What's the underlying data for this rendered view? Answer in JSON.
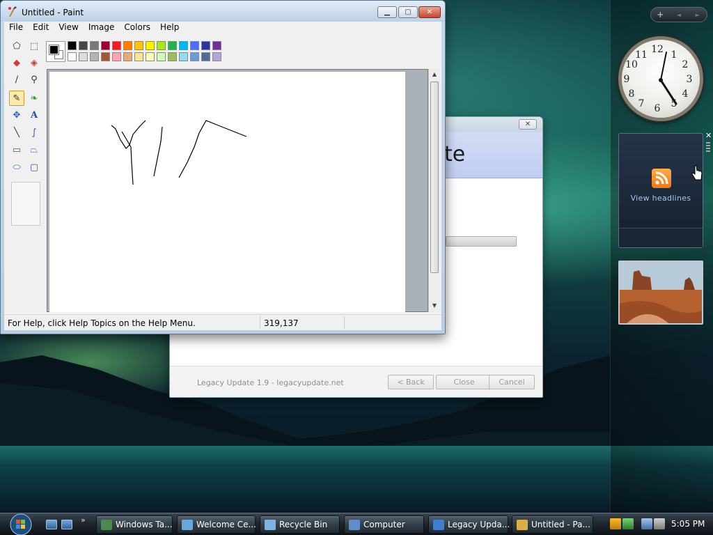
{
  "paint": {
    "title": "Untitled - Paint",
    "menus": [
      "File",
      "Edit",
      "View",
      "Image",
      "Colors",
      "Help"
    ],
    "status_help": "For Help, click Help Topics on the Help Menu.",
    "status_coords": "319,137",
    "palette_top": [
      "#000000",
      "#464646",
      "#787878",
      "#990030",
      "#ed1c24",
      "#ff7e00",
      "#ffc20e",
      "#fff200",
      "#a8e61d",
      "#22b14c",
      "#00b7ef",
      "#4d6df3",
      "#2f3699",
      "#6f3198"
    ],
    "palette_bottom": [
      "#ffffff",
      "#dcdcdc",
      "#b4b4b4",
      "#9c5a3c",
      "#ffa3b1",
      "#e5aa7a",
      "#f5e49c",
      "#fff9bd",
      "#d3f9bc",
      "#9dbb61",
      "#99d9ea",
      "#709ad1",
      "#546d8e",
      "#b5a5d5"
    ],
    "tools": [
      "free-select-icon",
      "rect-select-icon",
      "eraser-icon",
      "fill-icon",
      "picker-icon",
      "magnifier-icon",
      "pencil-icon",
      "brush-icon",
      "airbrush-icon",
      "text-icon",
      "line-icon",
      "curve-icon",
      "rectangle-icon",
      "polygon-icon",
      "ellipse-icon",
      "rounded-rect-icon"
    ]
  },
  "legacy_update": {
    "header_fragment": "te",
    "brand": "Legacy Update 1.9 - legacyupdate.net",
    "back_label": "< Back",
    "close_label": "Close",
    "cancel_label": "Cancel",
    "close_x": "✕"
  },
  "sidebar": {
    "controls": [
      "+",
      "◄",
      "►"
    ],
    "clock_numbers": [
      "12",
      "1",
      "2",
      "3",
      "4",
      "5",
      "6",
      "7",
      "8",
      "9",
      "10",
      "11"
    ],
    "feed_label": "View headlines"
  },
  "taskbar": {
    "tasks": [
      {
        "label": "Windows Ta...",
        "icon_color": "#4a8a4a"
      },
      {
        "label": "Welcome Ce...",
        "icon_color": "#6ba7d6"
      },
      {
        "label": "Recycle Bin",
        "icon_color": "#7fb4e0"
      },
      {
        "label": "Computer",
        "icon_color": "#5f8fc6"
      },
      {
        "label": "Legacy Upda...",
        "icon_color": "#3f7fd0"
      },
      {
        "label": "Untitled - Pa...",
        "icon_color": "#d8b04a"
      }
    ],
    "more": "»",
    "time": "5:05 PM"
  }
}
